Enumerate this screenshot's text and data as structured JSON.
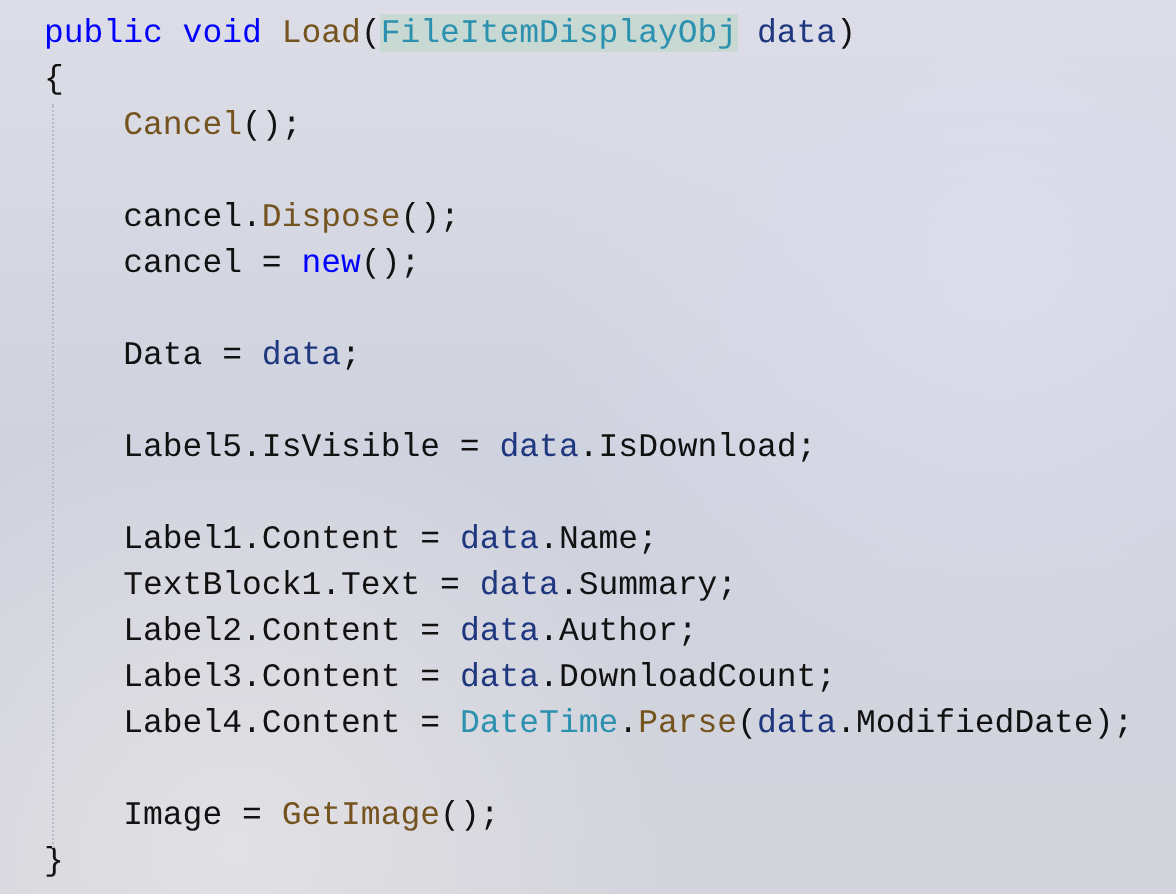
{
  "code_lines": [
    {
      "kind": "code",
      "tokens": [
        {
          "text": "public void",
          "kind": "keyword"
        },
        {
          "text": " Load",
          "kind": "method"
        },
        {
          "text": "(",
          "kind": "plain"
        },
        {
          "text": "FileItemDisplayObj",
          "kind": "type",
          "highlighted": true
        },
        {
          "text": " data",
          "kind": "param"
        },
        {
          "text": ")",
          "kind": "plain"
        }
      ]
    },
    {
      "kind": "code",
      "tokens": [
        {
          "text": "{",
          "kind": "plain"
        }
      ]
    },
    {
      "kind": "code",
      "tokens": [
        {
          "text": "    Cancel",
          "kind": "method"
        },
        {
          "text": "();",
          "kind": "plain"
        }
      ]
    },
    {
      "kind": "blank"
    },
    {
      "kind": "code",
      "tokens": [
        {
          "text": "    cancel.",
          "kind": "plain"
        },
        {
          "text": "Dispose",
          "kind": "method"
        },
        {
          "text": "();",
          "kind": "plain"
        }
      ]
    },
    {
      "kind": "code",
      "tokens": [
        {
          "text": "    cancel = ",
          "kind": "plain"
        },
        {
          "text": "new",
          "kind": "keyword"
        },
        {
          "text": "();",
          "kind": "plain"
        }
      ]
    },
    {
      "kind": "blank"
    },
    {
      "kind": "code",
      "tokens": [
        {
          "text": "    Data = ",
          "kind": "plain"
        },
        {
          "text": "data",
          "kind": "param"
        },
        {
          "text": ";",
          "kind": "plain"
        }
      ]
    },
    {
      "kind": "blank"
    },
    {
      "kind": "code",
      "tokens": [
        {
          "text": "    Label5.IsVisible = ",
          "kind": "plain"
        },
        {
          "text": "data",
          "kind": "param"
        },
        {
          "text": ".IsDownload;",
          "kind": "plain"
        }
      ]
    },
    {
      "kind": "blank"
    },
    {
      "kind": "code",
      "tokens": [
        {
          "text": "    Label1.Content = ",
          "kind": "plain"
        },
        {
          "text": "data",
          "kind": "param"
        },
        {
          "text": ".Name;",
          "kind": "plain"
        }
      ]
    },
    {
      "kind": "code",
      "tokens": [
        {
          "text": "    TextBlock1.Text = ",
          "kind": "plain"
        },
        {
          "text": "data",
          "kind": "param"
        },
        {
          "text": ".Summary;",
          "kind": "plain"
        }
      ]
    },
    {
      "kind": "code",
      "tokens": [
        {
          "text": "    Label2.Content = ",
          "kind": "plain"
        },
        {
          "text": "data",
          "kind": "param"
        },
        {
          "text": ".Author;",
          "kind": "plain"
        }
      ]
    },
    {
      "kind": "code",
      "tokens": [
        {
          "text": "    Label3.Content = ",
          "kind": "plain"
        },
        {
          "text": "data",
          "kind": "param"
        },
        {
          "text": ".DownloadCount;",
          "kind": "plain"
        }
      ]
    },
    {
      "kind": "code",
      "tokens": [
        {
          "text": "    Label4.Content = ",
          "kind": "plain"
        },
        {
          "text": "DateTime",
          "kind": "type"
        },
        {
          "text": ".",
          "kind": "plain"
        },
        {
          "text": "Parse",
          "kind": "method"
        },
        {
          "text": "(",
          "kind": "plain"
        },
        {
          "text": "data",
          "kind": "param"
        },
        {
          "text": ".ModifiedDate);",
          "kind": "plain"
        }
      ]
    },
    {
      "kind": "blank"
    },
    {
      "kind": "code",
      "tokens": [
        {
          "text": "    Image = ",
          "kind": "plain"
        },
        {
          "text": "GetImage",
          "kind": "method"
        },
        {
          "text": "();",
          "kind": "plain"
        }
      ]
    },
    {
      "kind": "code",
      "tokens": [
        {
          "text": "}",
          "kind": "plain"
        }
      ]
    }
  ]
}
